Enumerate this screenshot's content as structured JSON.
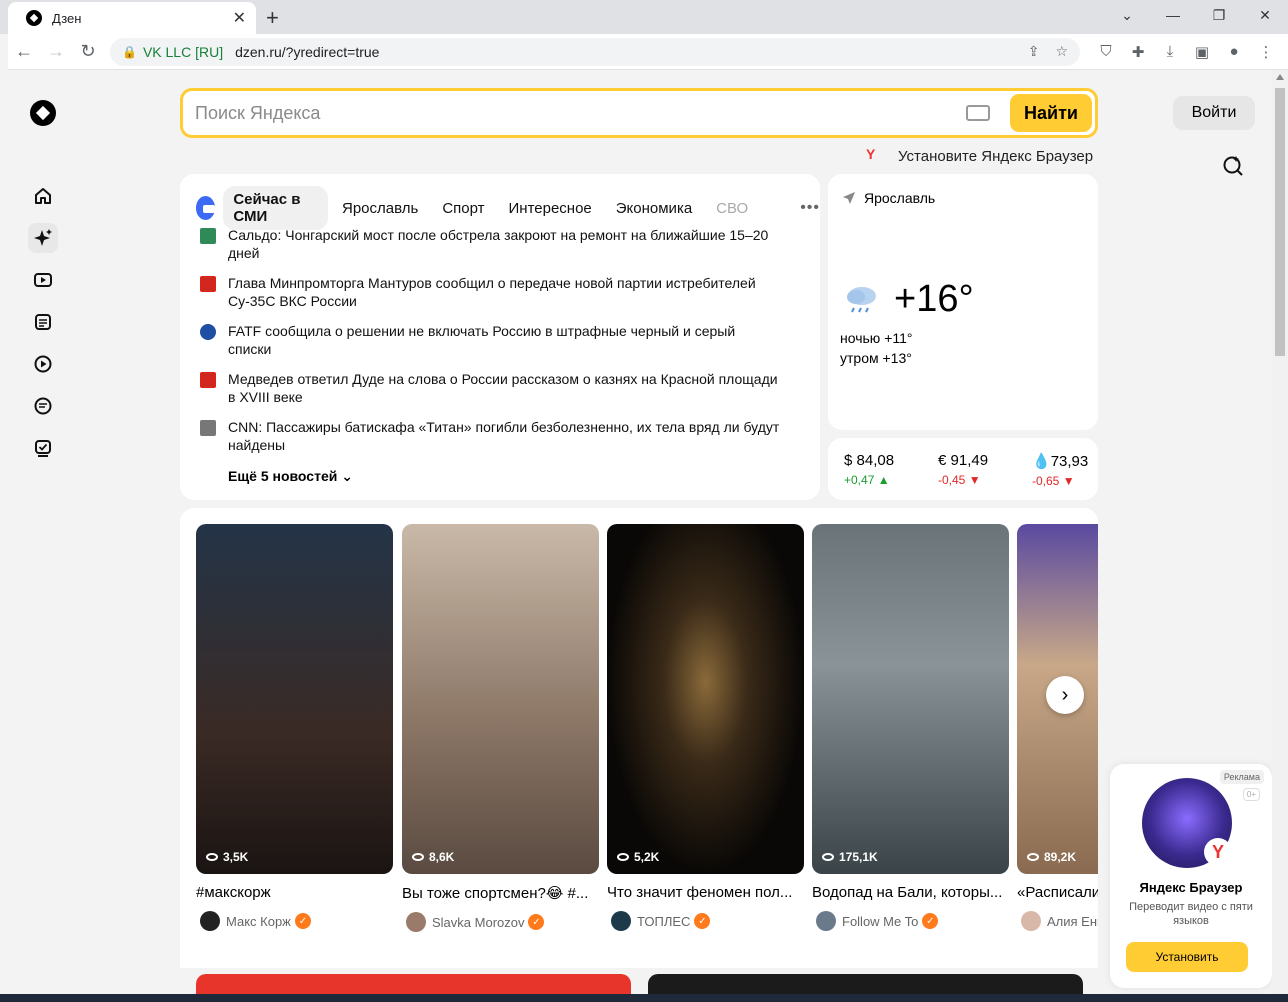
{
  "browser": {
    "tab_title": "Дзен",
    "cert": "VK LLC [RU]",
    "url": "dzen.ru/?yredirect=true"
  },
  "search": {
    "placeholder": "Поиск Яндекса",
    "button": "Найти"
  },
  "header": {
    "login": "Войти",
    "promo": "Установите Яндекс Браузер"
  },
  "news": {
    "tabs": [
      "Сейчас в СМИ",
      "Ярославль",
      "Спорт",
      "Интересное",
      "Экономика",
      "СВО"
    ],
    "items": [
      {
        "text": "Сальдо: Чонгарский мост после обстрела закроют на ремонт на ближайшие 15–20 дней",
        "color": "#2e8b57"
      },
      {
        "text": "Глава Минпромторга Мантуров сообщил о передаче новой партии истребителей Су-35С ВКС России",
        "color": "#d3261f"
      },
      {
        "text": "FATF сообщила о решении не включать Россию в штрафные черный и серый списки",
        "color": "#1f4fa3"
      },
      {
        "text": "Медведев ответил Дуде на слова о России рассказом о казнях на Красной площади в XVIII веке",
        "color": "#d3261f"
      },
      {
        "text": "CNN: Пассажиры батискафа «Титан» погибли безболезненно, их тела вряд ли будут найдены",
        "color": "#555555"
      }
    ],
    "more": "Ещё 5 новостей"
  },
  "weather": {
    "city": "Ярославль",
    "temp": "+16°",
    "night": "ночью +11°",
    "morning": "утром +13°"
  },
  "rates": [
    {
      "value": "$ 84,08",
      "delta": "+0,47",
      "dir": "up"
    },
    {
      "value": "€ 91,49",
      "delta": "-0,45",
      "dir": "down"
    },
    {
      "value": "73,93",
      "delta": "-0,65",
      "dir": "down"
    }
  ],
  "feed": [
    {
      "views": "3,5K",
      "title": "#макскорж",
      "author": "Макс Корж",
      "bg": "#3a4a5c"
    },
    {
      "views": "8,6K",
      "title": "Вы тоже спортсмен?😂 #...",
      "author": "Slavka Morozov",
      "bg": "#8a7a6a"
    },
    {
      "views": "5,2K",
      "title": "Что значит феномен пол...",
      "author": "ТОПЛЕС",
      "bg": "#1a1410"
    },
    {
      "views": "175,1K",
      "title": "Водопад на Бали, которы...",
      "author": "Follow Me To",
      "bg": "#5a6468"
    },
    {
      "views": "89,2K",
      "title": "«Расписали",
      "author": "Алия Ени",
      "bg": "#b89878"
    }
  ],
  "ad": {
    "tag": "Реклама",
    "age": "0+",
    "name": "Яндекс Браузер",
    "desc": "Переводит видео с пяти языков",
    "install": "Установить"
  }
}
